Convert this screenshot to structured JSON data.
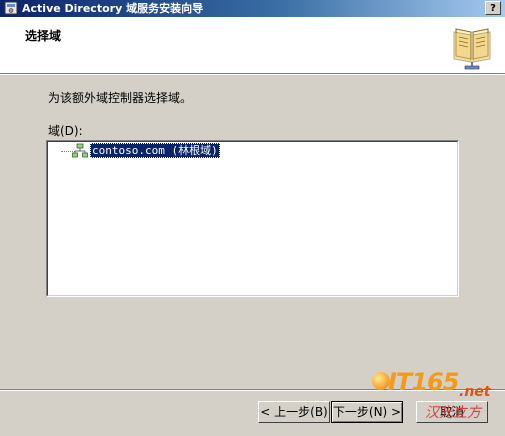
{
  "window": {
    "title": "Active Directory 域服务安装向导",
    "help_label": "?"
  },
  "header": {
    "title": "选择域",
    "icon": "book-icon"
  },
  "main": {
    "description": "为该额外域控制器选择域。",
    "domain_label": "域(D):",
    "tree": {
      "items": [
        {
          "label": "contoso.com (林根域)",
          "icon": "domain-tree-icon",
          "selected": true
        }
      ]
    }
  },
  "buttons": {
    "back": "< 上一步(B)",
    "next": "下一步(N) >",
    "cancel": "取消"
  },
  "watermark": {
    "logo": "IT165",
    "suffix": ".net",
    "tagline": "汉光立方"
  }
}
